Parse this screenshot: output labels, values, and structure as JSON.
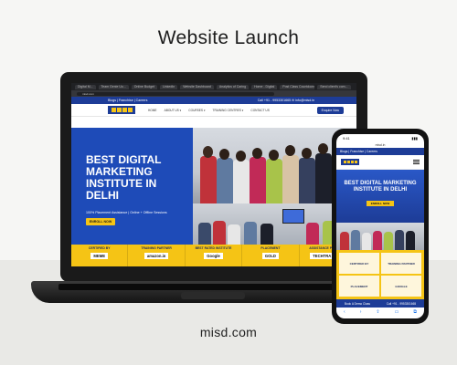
{
  "headline": "Website Launch",
  "footer_url": "misd.com",
  "laptop": {
    "browser_tabs": [
      "Digital M...",
      "Team Genie Uo...",
      "Online Budget",
      "LinkedIn",
      "Website Dashboard",
      "Analytics of Caring",
      "Home - Digital",
      "Post Class Countdown",
      "Send client's com..."
    ],
    "address": "misd.com",
    "site": {
      "topbar_left": "Blogs  |  Franchise  |  Careers",
      "topbar_right": "Call +91 - 9953301665     ✉ info@misd.in",
      "nav_items": [
        "HOME",
        "ABOUT US ▾",
        "COURSES ▾",
        "TRAINING CENTRES ▾",
        "CONTACT US"
      ],
      "nav_cta": "Enquire Now",
      "hero_title": "BEST DIGITAL MARKETING INSTITUTE IN DELHI",
      "hero_subtitle": "100% Placement Assistance | Online + Offline Sessions",
      "hero_button": "ENROLL NOW",
      "partners": [
        {
          "caption": "CERTIFIED BY",
          "brand": "MEME"
        },
        {
          "caption": "TRAINING PARTNER",
          "brand": "amazon.in"
        },
        {
          "caption": "BEST RATED INSTITUTE",
          "brand": "Google"
        },
        {
          "caption": "PLACEMENT",
          "brand": "GOLD"
        },
        {
          "caption": "ASSISTANCE PROVIDER",
          "brand": "TECHTRA DIGIT"
        }
      ]
    }
  },
  "phone": {
    "time": "9:41",
    "url": "misd.in",
    "strip": "Blogs  |  Franchise  |  Careers",
    "hero_title": "BEST DIGITAL MARKETING INSTITUTE IN DELHI",
    "hero_button": "ENROLL NOW",
    "partners": [
      "CERTIFIED BY",
      "TRAINING PARTNER",
      "PLACEMENT",
      "GOOGLE"
    ],
    "bottom_left": "Book A Demo Class",
    "bottom_right": "Call +91 - 9953301665",
    "nav_icons": [
      "‹",
      "›",
      "⇪",
      "▭",
      "⧉"
    ]
  }
}
